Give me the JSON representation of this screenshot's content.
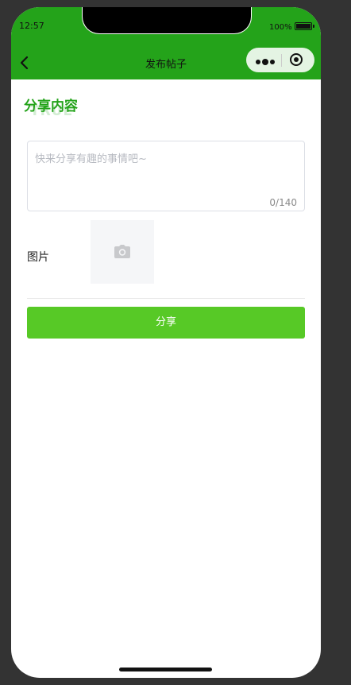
{
  "status_bar": {
    "time": "12:57",
    "battery": "100%"
  },
  "nav": {
    "title": "发布帖子",
    "back_icon": "chevron-left-icon",
    "more_icon": "more-dots-icon",
    "close_icon": "target-close-icon"
  },
  "section": {
    "title": "分享内容",
    "watermark": "TRUE"
  },
  "content_input": {
    "placeholder": "快来分享有趣的事情吧~",
    "count": "0/140"
  },
  "image_field": {
    "label": "图片",
    "icon": "camera-icon"
  },
  "actions": {
    "share_label": "分享"
  },
  "colors": {
    "nav_background": "#24a31a",
    "accent_green": "#24a31a",
    "button_green": "#57c926",
    "page_background": "#333333"
  }
}
